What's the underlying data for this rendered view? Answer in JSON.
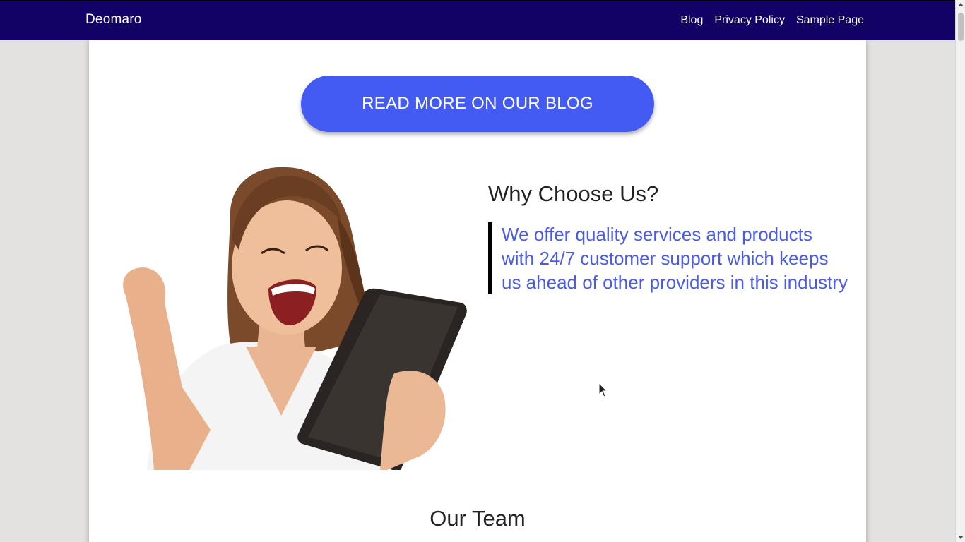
{
  "navbar": {
    "brand": "Deomaro",
    "links": [
      "Blog",
      "Privacy Policy",
      "Sample Page"
    ]
  },
  "cta": {
    "label": "READ MORE ON OUR BLOG"
  },
  "why": {
    "title": "Why Choose Us?",
    "quote": "We offer quality services and products with 24/7 customer support which keeps us ahead of other providers in this industry"
  },
  "team": {
    "title": "Our Team"
  },
  "colors": {
    "navbar_bg": "#130266",
    "accent_button": "#435bf3",
    "quote_text": "#4a5ce6",
    "page_bg": "#e3e2e0"
  },
  "icons": {
    "cursor": "arrow-cursor-icon",
    "scroll_up": "scroll-up-arrow-icon",
    "scroll_down": "scroll-down-arrow-icon"
  }
}
